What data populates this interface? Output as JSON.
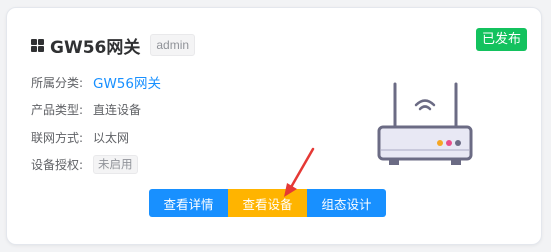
{
  "device": {
    "name": "GW56网关",
    "role_tag": "admin",
    "status": "已发布",
    "status_color": "#13c25e"
  },
  "info": [
    {
      "label": "所属分类:",
      "value": "GW56网关",
      "kind": "link"
    },
    {
      "label": "产品类型:",
      "value": "直连设备",
      "kind": "text"
    },
    {
      "label": "联网方式:",
      "value": "以太网",
      "kind": "text"
    },
    {
      "label": "设备授权:",
      "value": "未启用",
      "kind": "tag"
    }
  ],
  "actions": {
    "details": "查看详情",
    "view_devices": "查看设备",
    "config_design": "组态设计"
  },
  "colors": {
    "primary": "#1890ff",
    "warning": "#ffb400",
    "annotation": "#e53935"
  },
  "icons": {
    "title": "grid-icon",
    "product_image": "router-icon",
    "annotation": "red-arrow-icon"
  }
}
